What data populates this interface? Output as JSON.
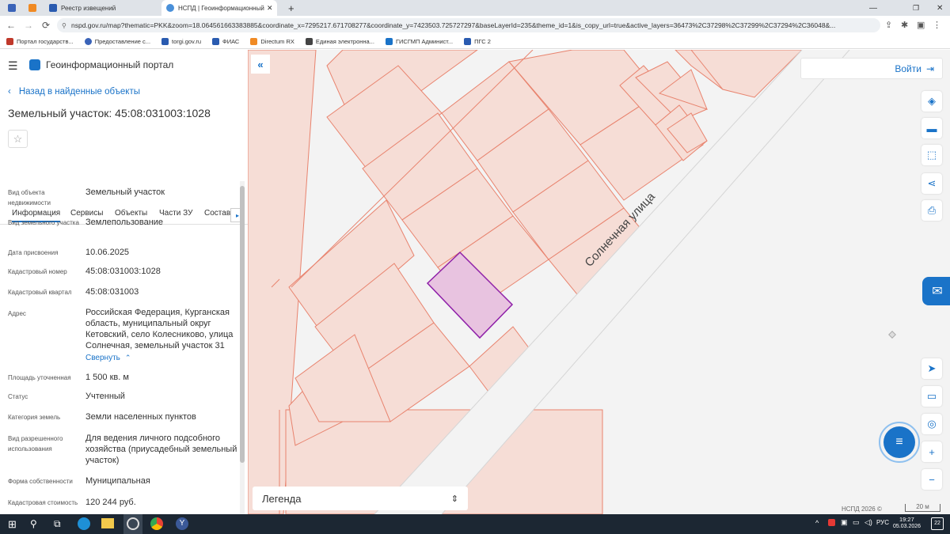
{
  "browser": {
    "tabs": [
      {
        "title": ""
      },
      {
        "title": ""
      },
      {
        "title": "Реестр извещений"
      },
      {
        "title": "НСПД | Геоинформационный п"
      }
    ],
    "url": "nspd.gov.ru/map?thematic=PKK&zoom=18.064561663383885&coordinate_x=7295217.671708277&coordinate_y=7423503.725727297&baseLayerId=235&theme_id=1&is_copy_url=true&active_layers=36473%2C37298%2C37299%2C37294%2C36048&...",
    "bookmarks": [
      "Портал государств...",
      "Предоставление с...",
      "torgi.gov.ru",
      "ФИАС",
      "Directum RX",
      "Единая электронна...",
      "ГИСГМП Админист...",
      "ПГС 2"
    ]
  },
  "app": {
    "title": "Геоинформационный портал",
    "back_link": "Назад в найденные объекты",
    "object_title": "Земельный участок: 45:08:031003:1028",
    "login": "Войти"
  },
  "panel": {
    "tabs": [
      "Информация",
      "Сервисы",
      "Объекты",
      "Части ЗУ",
      "Состав"
    ],
    "fields": [
      {
        "label": "Вид объекта недвижимости",
        "value": "Земельный участок"
      },
      {
        "label": "Вид земельного участка",
        "value": "Землепользование"
      },
      {
        "label": "Дата присвоения",
        "value": "10.06.2025"
      },
      {
        "label": "Кадастровый номер",
        "value": "45:08:031003:1028"
      },
      {
        "label": "Кадастровый квартал",
        "value": "45:08:031003"
      },
      {
        "label": "Адрес",
        "value": "Российская Федерация, Курганская область, муниципальный округ Кетовский, село Колесниково, улица Солнечная, земельный участок 31"
      },
      {
        "label": "Площадь уточненная",
        "value": "1 500 кв. м"
      },
      {
        "label": "Статус",
        "value": "Учтенный"
      },
      {
        "label": "Категория земель",
        "value": "Земли населенных пунктов"
      },
      {
        "label": "Вид разрешенного использования",
        "value": "Для ведения личного подсобного хозяйства (приусадебный земельный участок)"
      },
      {
        "label": "Форма собственности",
        "value": "Муниципальная"
      },
      {
        "label": "Кадастровая стоимость",
        "value": "120 244 руб."
      }
    ],
    "collapse_link": "Свернуть"
  },
  "map": {
    "street_label": "Солнечная улица",
    "legend": "Легенда",
    "copyright": "НСПД 2026 ©",
    "scale": "20 м"
  },
  "taskbar": {
    "lang": "РУС",
    "time": "19:27",
    "date": "05.03.2026",
    "notifications": "22"
  },
  "colors": {
    "accent": "#1a73c8",
    "parcel_line": "#e8836e",
    "parcel_fill": "#f6ddd6",
    "selected_stroke": "#8e1fa8",
    "selected_fill": "#e8c3e0"
  }
}
